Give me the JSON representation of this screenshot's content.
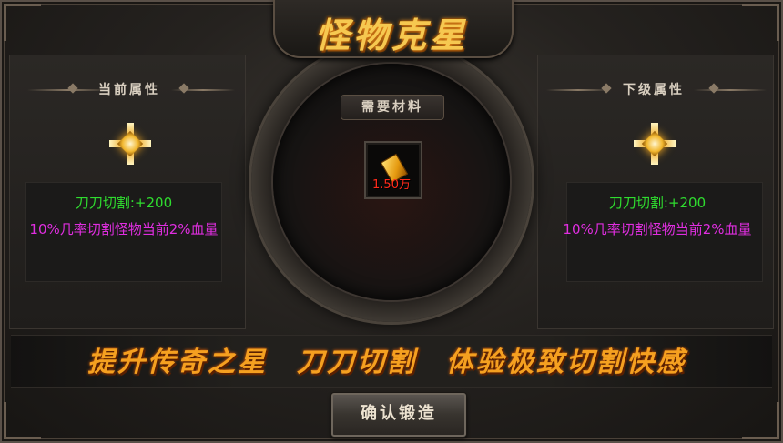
{
  "title": "怪物克星",
  "left_panel": {
    "header": "当前属性",
    "stat_line1": "刀刀切割:+200",
    "stat_line2": "10%几率切割怪物当前2%血量"
  },
  "right_panel": {
    "header": "下级属性",
    "stat_line1": "刀刀切割:+200",
    "stat_line2": "10%几率切割怪物当前2%血量"
  },
  "material": {
    "label": "需要材料",
    "item_icon": "gold-ingot-icon",
    "quantity": "1.50万"
  },
  "banner": {
    "slogan_1": "提升传奇之星",
    "slogan_2": "刀刀切割",
    "slogan_3": "体验极致切割快感"
  },
  "confirm_button": "确认锻造",
  "colors": {
    "stat_green": "#2fdc2f",
    "stat_magenta": "#e02ee0",
    "title_gold": "#f6c850",
    "slogan_orange": "#f5a020",
    "quantity_red": "#ff2a1a"
  }
}
